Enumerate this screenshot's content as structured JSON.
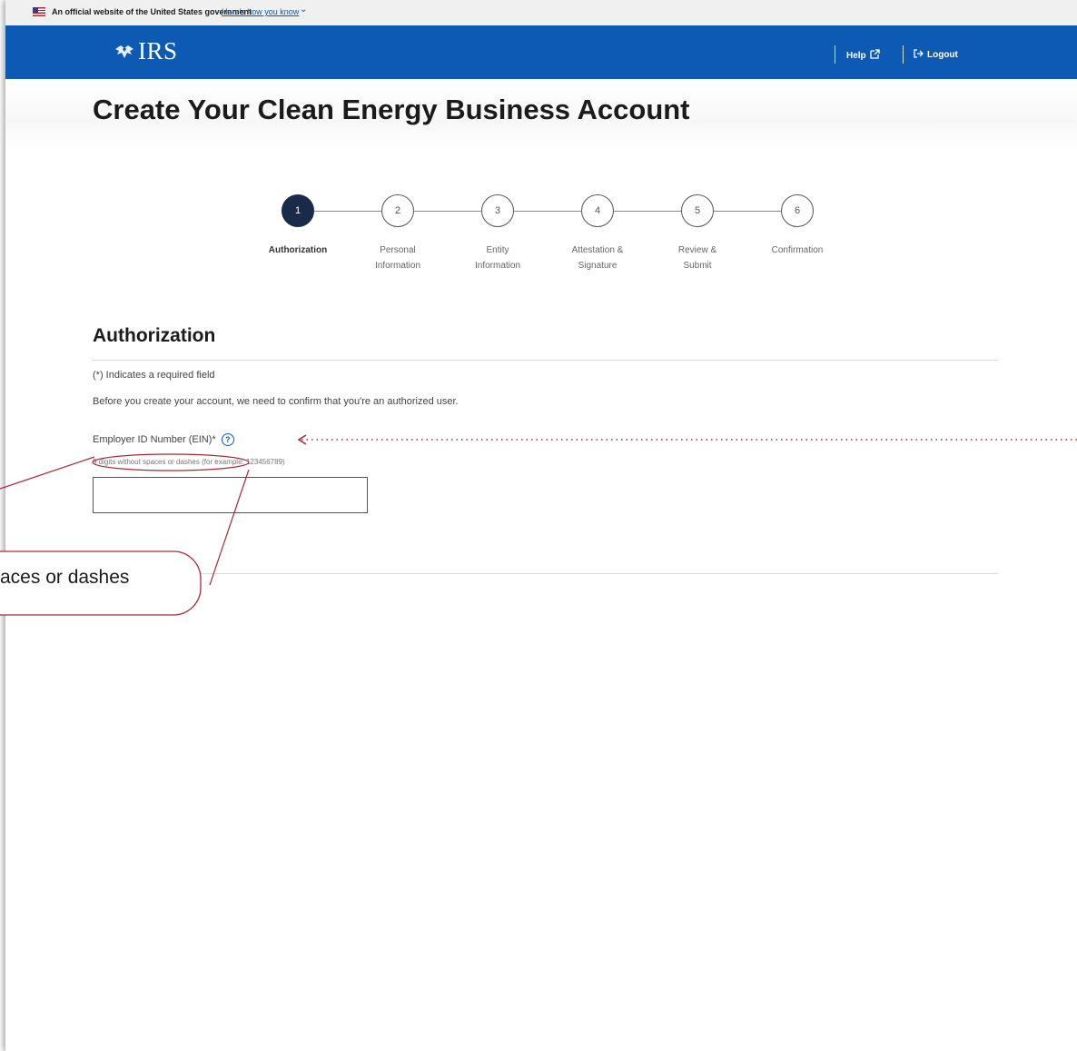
{
  "gov_banner": {
    "text": "An official website of the United States government",
    "link": "Here's how you know"
  },
  "header": {
    "logo_text": "IRS",
    "help_label": "Help",
    "logout_label": "Logout"
  },
  "page": {
    "title": "Create Your Clean Energy Business Account"
  },
  "stepper": {
    "current_step": 1,
    "steps": [
      {
        "number": "1",
        "line1": "Authorization",
        "line2": ""
      },
      {
        "number": "2",
        "line1": "Personal",
        "line2": "Information"
      },
      {
        "number": "3",
        "line1": "Entity",
        "line2": "Information"
      },
      {
        "number": "4",
        "line1": "Attestation &",
        "line2": "Signature"
      },
      {
        "number": "5",
        "line1": "Review &",
        "line2": "Submit"
      },
      {
        "number": "6",
        "line1": "Confirmation",
        "line2": ""
      }
    ]
  },
  "form": {
    "section_title": "Authorization",
    "required_note": "(*) Indicates a required field",
    "intro": "Before you create your account, we need to confirm that you're an authorized user.",
    "ein_label": "Employer ID Number (EIN)*",
    "ein_hint_circled": "9 digits without spaces or dashes",
    "ein_hint_rest": " (for example: 123456789)",
    "ein_value": ""
  },
  "annotation": {
    "callout_text": "aces or dashes",
    "accent_color": "#a52a3a"
  }
}
